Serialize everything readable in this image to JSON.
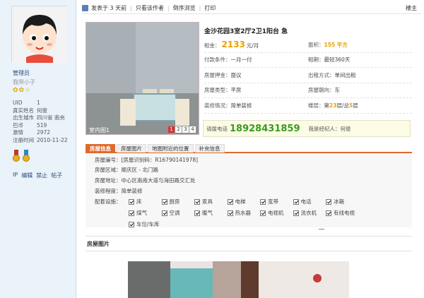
{
  "user": {
    "name": "管理员",
    "rank": "我带小子",
    "stars": "✿✿☆",
    "profile": [
      {
        "k": "UID",
        "v": "1"
      },
      {
        "k": "真实姓名",
        "v": "何俊"
      },
      {
        "k": "出生城市",
        "v": "四川省 南充"
      },
      {
        "k": "巴币",
        "v": "519"
      },
      {
        "k": "激情",
        "v": "2972"
      },
      {
        "k": "注册时间",
        "v": "2010-11-22"
      }
    ],
    "actions": [
      "IP",
      "编辑",
      "禁止",
      "帖子"
    ]
  },
  "topbar": {
    "posted": "发表于 3 天前",
    "only_author": "只看该作者",
    "reverse": "倒序浏览",
    "print": "打印",
    "floor": "楼主"
  },
  "listing": {
    "title": "金沙花园3室2厅2卫1阳台 急",
    "photo_caption": "室内图1",
    "photo_pages": [
      "1",
      "2",
      "3",
      "4"
    ],
    "rent_label": "租金：",
    "rent_value": "2133",
    "rent_unit": "元/月",
    "area_label": "面积：",
    "area_value": "155 平方",
    "payment_label": "付款条件：",
    "payment_value": "一月一付",
    "period_label": "租期：",
    "period_value": "最短360天",
    "deposit_label": "房屋押金：",
    "deposit_value": "面议",
    "mode_label": "出租方式：",
    "mode_value": "单间出租",
    "type_label": "房屋类型：",
    "type_value": "平房",
    "orient_label": "房屋朝向：",
    "orient_value": "东",
    "decor_label": "装修情况：",
    "decor_value": "简单装修",
    "floor_label": "楼层：",
    "floor_prefix": "第",
    "floor_value": "23",
    "floor_mid": "层/总",
    "floor_total": "5",
    "floor_suffix": "层",
    "contact_label": "请拨电话",
    "phone": "18928431859",
    "agent": "我是经纪人：何俊"
  },
  "tabs": [
    "房屋信息",
    "房屋图片",
    "地图附近的位置",
    "补充信息"
  ],
  "details": {
    "code": "房屋编号：[房屋识别码：R16790141978]",
    "region": "房屋区域：顺庆区 - 北门路",
    "address": "房屋地址：中心区南南大道与海田路交汇处",
    "decoration": "装修程度：简单装修",
    "facilities_label": "配套设施：",
    "facilities": [
      "床",
      "厨房",
      "家具",
      "电梯",
      "宽带",
      "电话",
      "冰箱",
      "煤气",
      "空调",
      "暖气",
      "热水器",
      "电视机",
      "洗衣机",
      "有线电视",
      "车位/车库"
    ]
  },
  "section_title": "房屋图片"
}
